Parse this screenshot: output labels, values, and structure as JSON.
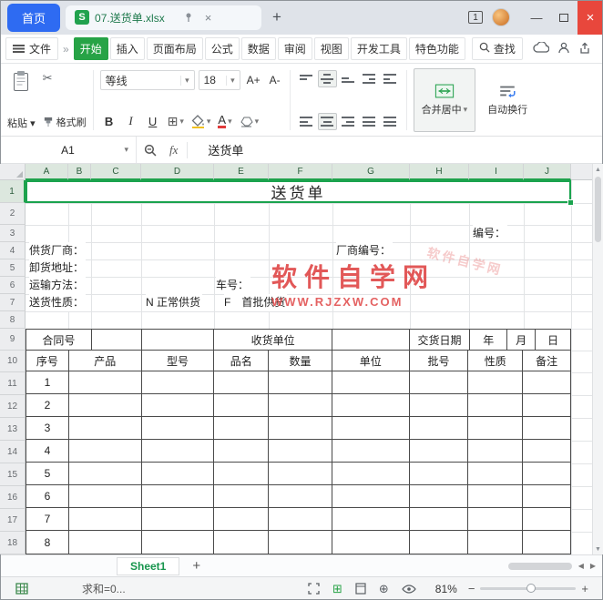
{
  "colors": {
    "accent_green": "#27a346",
    "selection_green": "#1aa34e",
    "tab_blue": "#2e6bf2",
    "close_red": "#e8473c",
    "watermark_red": "#df4646"
  },
  "icons": {
    "close": "×",
    "caret_down": "▾",
    "scissors": "✂",
    "borders": "⊞",
    "dots": "⋮",
    "collapse": "∧",
    "left": "◀",
    "right": "▶",
    "up": "▲",
    "down": "▼",
    "grid": "⊞",
    "page_break": "⊕",
    "overflow": "»"
  },
  "titlebar": {
    "home_tab": "首页",
    "doc_icon": "S",
    "doc_title": "07.送货单.xlsx",
    "new_tab": "+",
    "badge": "1",
    "minimize": "—"
  },
  "menubar": {
    "file": "文件",
    "tabs": [
      "开始",
      "插入",
      "页面布局",
      "公式",
      "数据",
      "审阅",
      "视图",
      "开发工具",
      "特色功能"
    ],
    "find": "查找"
  },
  "toolbar": {
    "paste": "粘贴",
    "format_painter": "格式刷",
    "font_name": "等线",
    "font_size": "18",
    "grow": "A+",
    "shrink": "A-",
    "bold": "B",
    "italic": "I",
    "underline": "U",
    "merge": "合并居中",
    "wrap": "自动换行"
  },
  "formula_bar": {
    "cell_ref": "A1",
    "fx": "fx",
    "content": "送货单"
  },
  "sheet": {
    "col_letters": [
      "A",
      "B",
      "C",
      "D",
      "E",
      "F",
      "G",
      "H",
      "I",
      "J"
    ],
    "row_numbers": [
      "1",
      "2",
      "3",
      "4",
      "5",
      "6",
      "7",
      "8",
      "9",
      "10",
      "11",
      "12",
      "13",
      "14",
      "15",
      "16",
      "17",
      "18"
    ],
    "title": "送货单",
    "form_labels": {
      "number": "编号：",
      "supplier": "供货厂商：",
      "supplier_code": "厂商编号：",
      "address": "卸货地址：",
      "transport": "运输方法：",
      "vehicle": "车号：",
      "nature": "送货性质：",
      "normal": "N 正常供货",
      "first": "F　首批供货"
    },
    "watermark": {
      "line1": "软件自学网",
      "line2": "WWW.RJZXW.COM"
    },
    "table": {
      "header_row": [
        "合同号",
        "",
        "",
        "收货单位",
        "",
        "交货日期",
        "年",
        "月",
        "日"
      ],
      "columns": [
        "序号",
        "产品",
        "型号",
        "品名",
        "数量",
        "单位",
        "批号",
        "性质",
        "备注"
      ],
      "serials": [
        "1",
        "2",
        "3",
        "4",
        "5",
        "6",
        "7",
        "8"
      ]
    }
  },
  "sheet_bar": {
    "active_tab": "Sheet1",
    "add": "+"
  },
  "status_bar": {
    "sum": "求和=0...",
    "zoom": "81%",
    "zoom_out": "−",
    "zoom_in": "+"
  }
}
